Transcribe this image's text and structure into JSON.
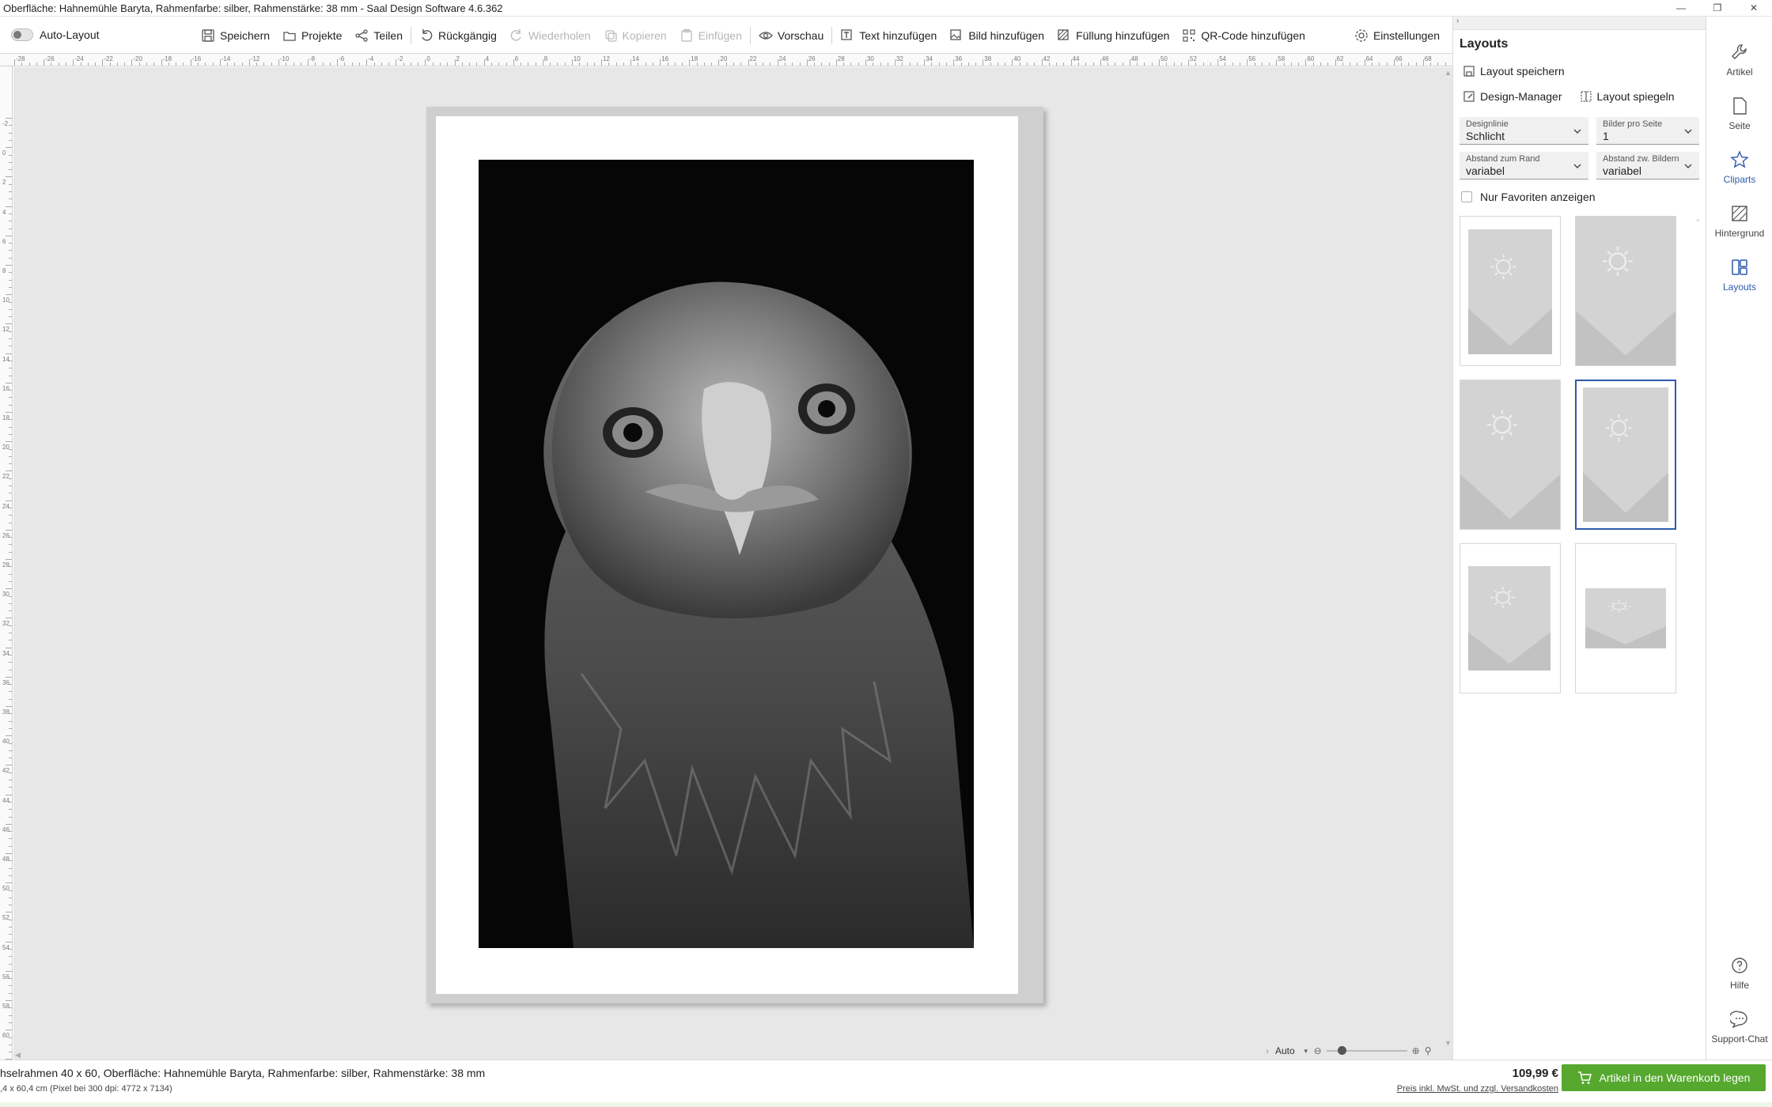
{
  "window": {
    "title": "Oberfläche: Hahnemühle Baryta, Rahmenfarbe: silber, Rahmenstärke: 38 mm - Saal Design Software 4.6.362"
  },
  "toolbar": {
    "auto_layout": "Auto-Layout",
    "save": "Speichern",
    "projects": "Projekte",
    "share": "Teilen",
    "undo": "Rückgängig",
    "redo": "Wiederholen",
    "copy": "Kopieren",
    "paste": "Einfügen",
    "preview": "Vorschau",
    "add_text": "Text hinzufügen",
    "add_image": "Bild hinzufügen",
    "add_fill": "Füllung hinzufügen",
    "add_qr": "QR-Code hinzufügen",
    "settings": "Einstellungen"
  },
  "ruler": {
    "top_labels": [
      "-28",
      "-26",
      "-24",
      "-22",
      "-20",
      "-18",
      "-16",
      "-14",
      "-12",
      "-10",
      "-8",
      "-6",
      "-4",
      "-2",
      "0",
      "2",
      "4",
      "6",
      "8",
      "10",
      "12",
      "14",
      "16",
      "18",
      "20",
      "22",
      "24",
      "26",
      "28",
      "30",
      "32",
      "34",
      "36",
      "38",
      "40",
      "42",
      "44",
      "46",
      "48",
      "50",
      "52",
      "54",
      "56",
      "58",
      "60",
      "62",
      "64",
      "66",
      "68"
    ],
    "left_labels": [
      "-2",
      "0",
      "2",
      "4",
      "6",
      "8",
      "10",
      "12",
      "14",
      "16",
      "18",
      "20",
      "22",
      "24",
      "26",
      "28",
      "30",
      "32",
      "34",
      "36",
      "38",
      "40",
      "42",
      "44",
      "46",
      "48",
      "50",
      "52",
      "54",
      "56",
      "58",
      "60",
      "62"
    ]
  },
  "zoom": {
    "mode": "Auto"
  },
  "panel": {
    "title": "Layouts",
    "save_layout": "Layout speichern",
    "design_manager": "Design-Manager",
    "mirror_layout": "Layout spiegeln",
    "design_line": {
      "label": "Designlinie",
      "value": "Schlicht"
    },
    "images_per_page": {
      "label": "Bilder pro Seite",
      "value": "1"
    },
    "margin": {
      "label": "Abstand zum Rand",
      "value": "variabel"
    },
    "spacing": {
      "label": "Abstand zw. Bildern",
      "value": "variabel"
    },
    "favorites_only": "Nur Favoriten anzeigen",
    "selected_layout_index": 3
  },
  "sidenav": {
    "items": [
      "Artikel",
      "Seite",
      "Cliparts",
      "Hintergrund",
      "Layouts"
    ],
    "help": "Hilfe",
    "support": "Support-Chat"
  },
  "status": {
    "product": "hselrahmen 40 x 60, Oberfläche: Hahnemühle Baryta, Rahmenfarbe: silber, Rahmenstärke: 38 mm",
    "dimensions": ",4 x 60,4 cm (Pixel bei 300 dpi: 4772 x 7134)",
    "price": "109,99 €",
    "price_note": "Preis inkl. MwSt. und zzgl. Versandkosten",
    "cart_button": "Artikel in den Warenkorb legen"
  },
  "colors": {
    "accent": "#2e5aac",
    "cart_green": "#56a82f",
    "canvas_bg": "#e7e7e7",
    "frame_silver": "#cfcfcf"
  }
}
